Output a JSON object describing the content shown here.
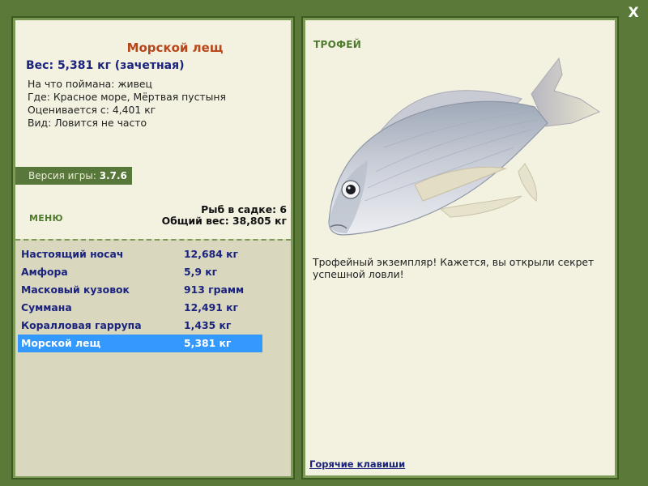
{
  "close_label": "X",
  "fish": {
    "title": "Морской лещ",
    "weight": "Вес: 5,381 кг (зачетная)",
    "info": [
      "На что поймана: живец",
      "Где: Красное море, Мёртвая пустыня",
      "Оценивается с: 4,401 кг",
      "Вид: Ловится не часто"
    ]
  },
  "version": {
    "label": "Версия игры:",
    "value": "3.7.6"
  },
  "menu_label": "МЕНЮ",
  "stats": {
    "count": "Рыб в садке: 6",
    "total_weight": "Общий вес: 38,805 кг"
  },
  "catch_list": [
    {
      "name": "Настоящий носач",
      "weight": "12,684 кг",
      "selected": false
    },
    {
      "name": "Амфора",
      "weight": "5,9 кг",
      "selected": false
    },
    {
      "name": "Масковый кузовок",
      "weight": "913 грамм",
      "selected": false
    },
    {
      "name": "Суммана",
      "weight": "12,491 кг",
      "selected": false
    },
    {
      "name": "Коралловая гаррупа",
      "weight": "1,435 кг",
      "selected": false
    },
    {
      "name": "Морской лещ",
      "weight": "5,381 кг",
      "selected": true
    }
  ],
  "trophy": {
    "label": "ТРОФЕЙ",
    "text": "Трофейный экземпляр! Кажется, вы открыли секрет успешной ловли!"
  },
  "hotkeys_link": "Горячие клавиши",
  "colors": {
    "background": "#5b7a3a",
    "panel": "#f3f1e0",
    "list_bg": "#d9d7bd",
    "accent_title": "#b9451a",
    "list_text": "#1a237e",
    "selection": "#3399ff"
  }
}
